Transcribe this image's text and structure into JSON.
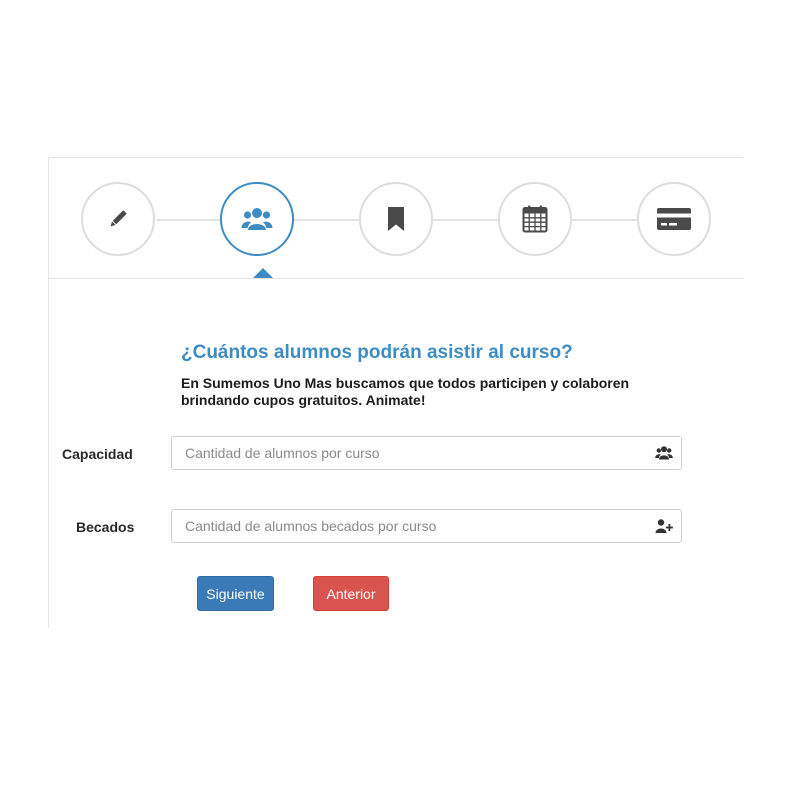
{
  "wizard": {
    "steps": [
      {
        "icon": "pencil-icon",
        "active": false
      },
      {
        "icon": "users-icon",
        "active": true
      },
      {
        "icon": "bookmark-icon",
        "active": false
      },
      {
        "icon": "calendar-icon",
        "active": false
      },
      {
        "icon": "credit-card-icon",
        "active": false
      }
    ],
    "accent_color": "#3d8cc4"
  },
  "form": {
    "question": "¿Cuántos alumnos podrán asistir al curso?",
    "subtitle": "En Sumemos Uno Mas buscamos que todos participen y colaboren brindando cupos gratuitos. Animate!",
    "capacidad": {
      "label": "Capacidad",
      "placeholder": "Cantidad de alumnos por curso",
      "icon": "users-icon"
    },
    "becados": {
      "label": "Becados",
      "placeholder": "Cantidad de alumnos becados por curso",
      "icon": "user-plus-icon"
    }
  },
  "buttons": {
    "next_label": "Siguiente",
    "next_color": "#3a7ab7",
    "prev_label": "Anterior",
    "prev_color": "#d9534f"
  }
}
